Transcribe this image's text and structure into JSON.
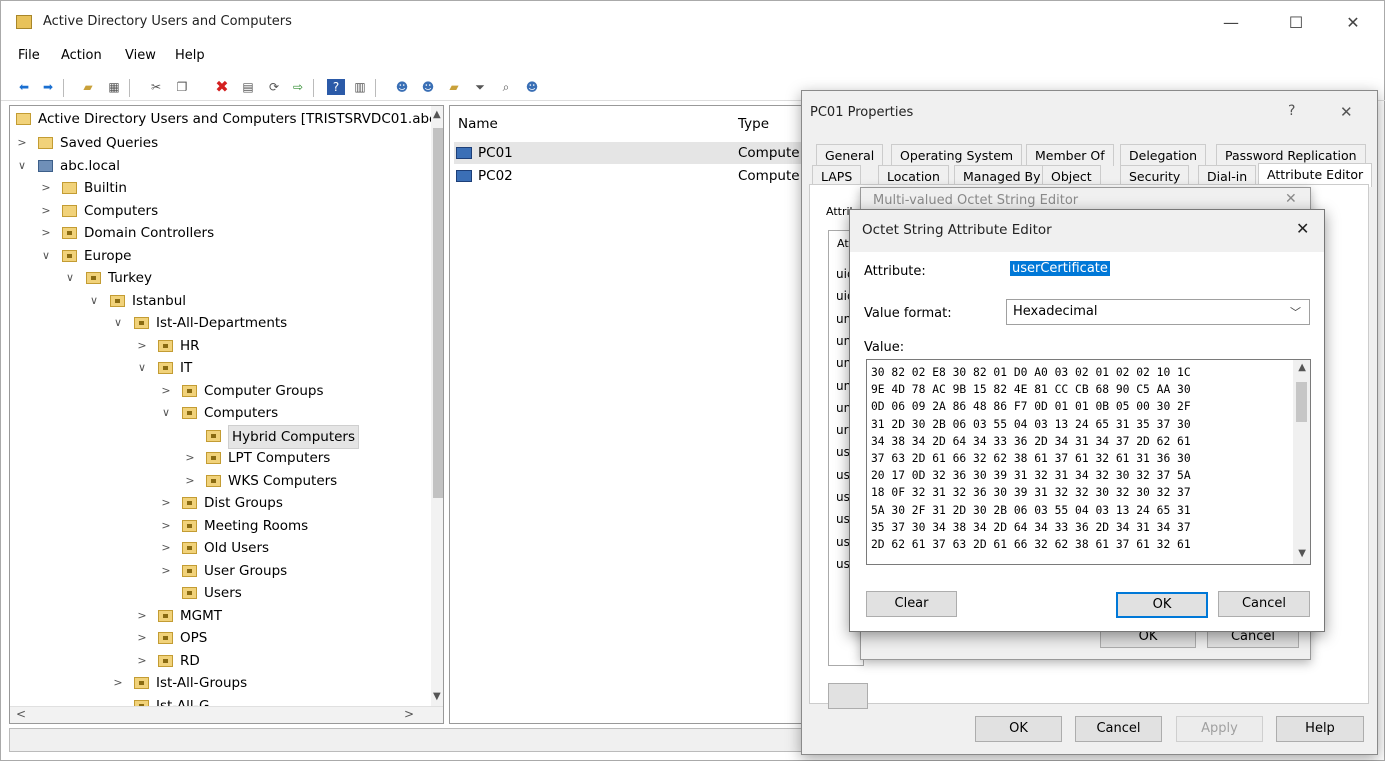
{
  "window": {
    "title": "Active Directory Users and Computers",
    "controls": {
      "minimize": "—",
      "maximize": "☐",
      "close": "✕"
    }
  },
  "menu": [
    "File",
    "Action",
    "View",
    "Help"
  ],
  "toolbar": {
    "icons": [
      "back-icon",
      "forward-icon",
      "up-folder-icon",
      "show-console-tree-icon",
      "cut-icon",
      "copy-icon",
      "delete-icon",
      "properties-icon",
      "refresh-icon",
      "export-icon",
      "help-icon",
      "view-icon",
      "new-user-icon",
      "new-group-icon",
      "new-ou-icon",
      "filter-icon",
      "find-icon",
      "add-to-group-icon"
    ]
  },
  "tree": {
    "root": "Active Directory Users and Computers [TRISTSRVDC01.abc",
    "items": [
      "Saved Queries",
      "abc.local",
      "Builtin",
      "Computers",
      "Domain Controllers",
      "Europe",
      "Turkey",
      "Istanbul",
      "Ist-All-Departments",
      "HR",
      "IT",
      "Computer Groups",
      "Computers",
      "Hybrid Computers",
      "LPT Computers",
      "WKS Computers",
      "Dist Groups",
      "Meeting Rooms",
      "Old Users",
      "User Groups",
      "Users",
      "MGMT",
      "OPS",
      "RD",
      "Ist-All-Groups",
      "Ist-All-G..."
    ]
  },
  "list": {
    "columns": [
      "Name",
      "Type"
    ],
    "rows": [
      {
        "name": "PC01",
        "type": "Compute"
      },
      {
        "name": "PC02",
        "type": "Compute"
      }
    ]
  },
  "props": {
    "title": "PC01 Properties",
    "help": "?",
    "close": "✕",
    "tabs_row1": [
      "General",
      "Operating System",
      "Member Of",
      "Delegation",
      "Password Replication"
    ],
    "tabs_row2": [
      "LAPS",
      "Location",
      "Managed By",
      "Object",
      "Security",
      "Dial-in",
      "Attribute Editor"
    ],
    "page_label": "Attrib",
    "list_header": "Att",
    "attr_prefixes": [
      "uid",
      "uid",
      "un",
      "un",
      "un",
      "un",
      "un",
      "url",
      "us",
      "us",
      "us",
      "us",
      "us",
      "us"
    ],
    "buttons": {
      "ok": "OK",
      "cancel": "Cancel",
      "apply": "Apply",
      "help": "Help"
    }
  },
  "multi": {
    "title": "Multi-valued Octet String Editor",
    "close": "✕",
    "ok": "OK",
    "cancel": "Cancel"
  },
  "octet": {
    "title": "Octet String Attribute Editor",
    "close": "✕",
    "attribute_label": "Attribute:",
    "attribute_value": "userCertificate",
    "format_label": "Value format:",
    "format_value": "Hexadecimal",
    "value_label": "Value:",
    "hex_lines": [
      "30 82 02 E8 30 82 01 D0 A0 03 02 01 02 02 10 1C",
      "9E 4D 78 AC 9B 15 82 4E 81 CC CB 68 90 C5 AA 30",
      "0D 06 09 2A 86 48 86 F7 0D 01 01 0B 05 00 30 2F",
      "31 2D 30 2B 06 03 55 04 03 13 24 65 31 35 37 30",
      "34 38 34 2D 64 34 33 36 2D 34 31 34 37 2D 62 61",
      "37 63 2D 61 66 32 62 38 61 37 61 32 61 31 36 30",
      "20 17 0D 32 36 30 39 31 32 31 34 32 30 32 37 5A",
      "18 0F 32 31 32 36 30 39 31 32 32 30 32 30 32 37",
      "5A 30 2F 31 2D 30 2B 06 03 55 04 03 13 24 65 31",
      "35 37 30 34 38 34 2D 64 34 33 36 2D 34 31 34 37",
      "2D 62 61 37 63 2D 61 66 32 62 38 61 37 61 32 61"
    ],
    "clear": "Clear",
    "ok": "OK",
    "cancel": "Cancel"
  }
}
